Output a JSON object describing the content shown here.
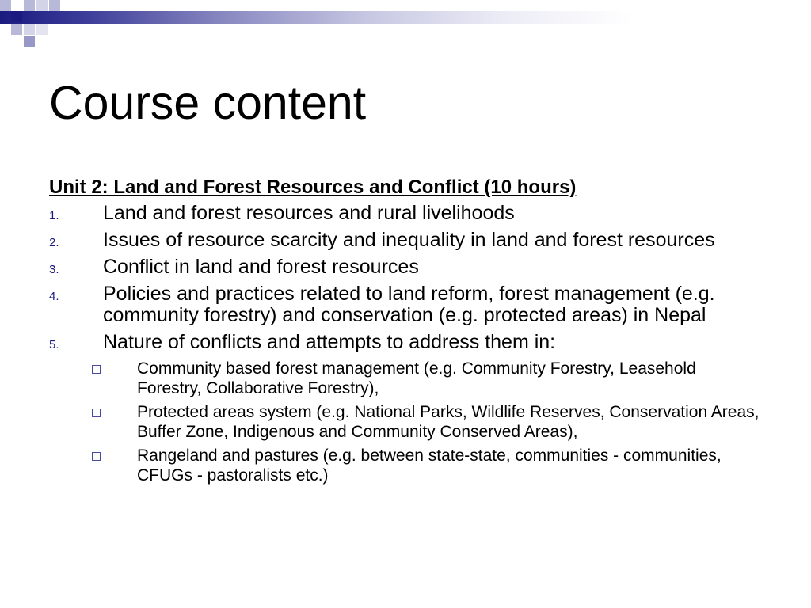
{
  "slide": {
    "title": "Course content",
    "unit_heading": "Unit 2: Land and Forest Resources and Conflict (10 hours)",
    "items": [
      {
        "number": "1.",
        "text": "Land and forest resources and rural livelihoods"
      },
      {
        "number": "2.",
        "text": "Issues of resource scarcity and inequality in land and forest resources"
      },
      {
        "number": "3.",
        "text": "Conflict in land and forest resources"
      },
      {
        "number": "4.",
        "text": "Policies and practices related to land reform, forest management (e.g. community forestry) and conservation (e.g. protected areas) in Nepal"
      },
      {
        "number": "5.",
        "text": "Nature of conflicts and attempts to address them in:"
      }
    ],
    "subitems": [
      {
        "bullet_icon": "hollow-square-bullet",
        "text": "Community based forest management (e.g. Community Forestry, Leasehold Forestry, Collaborative Forestry),"
      },
      {
        "bullet_icon": "hollow-square-bullet",
        "text": "Protected areas system (e.g. National Parks, Wildlife Reserves, Conservation Areas, Buffer Zone, Indigenous and Community Conserved Areas),"
      },
      {
        "bullet_icon": "hollow-square-bullet",
        "text": "Rangeland and pastures (e.g. between state-state, communities - communities, CFUGs - pastoralists etc.)"
      }
    ]
  },
  "colors": {
    "accent": "#1a1a80",
    "text": "#000000",
    "background": "#ffffff"
  }
}
